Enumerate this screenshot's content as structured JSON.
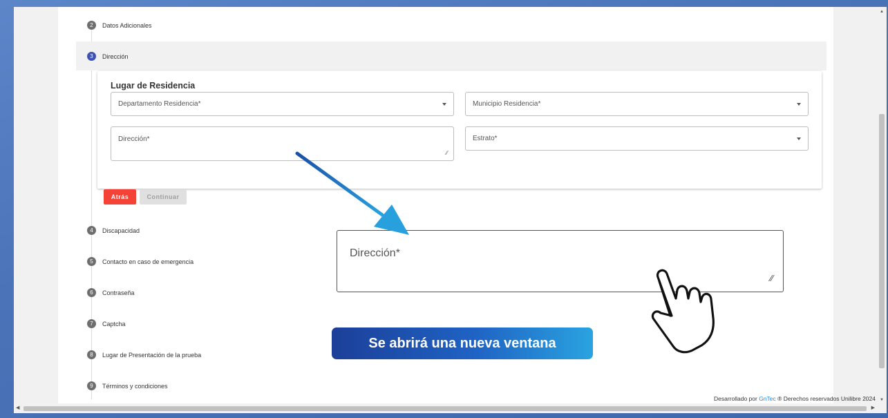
{
  "steps": [
    {
      "num": "2",
      "label": "Datos Adicionales"
    },
    {
      "num": "3",
      "label": "Dirección"
    },
    {
      "num": "4",
      "label": "Discapacidad"
    },
    {
      "num": "5",
      "label": "Contacto en caso de emergencia"
    },
    {
      "num": "6",
      "label": "Contraseña"
    },
    {
      "num": "7",
      "label": "Captcha"
    },
    {
      "num": "8",
      "label": "Lugar de Presentación de la prueba"
    },
    {
      "num": "9",
      "label": "Términos y condiciones"
    }
  ],
  "form": {
    "section_title": "Lugar de Residencia",
    "departamento_placeholder": "Departamento Residencia*",
    "municipio_placeholder": "Municipio Residencia*",
    "direccion_placeholder": "Dirección*",
    "estrato_placeholder": "Estrato*"
  },
  "buttons": {
    "back": "Atrás",
    "next": "Continuar"
  },
  "callout": {
    "zoom_label": "Dirección*",
    "banner": "Se abrirá una nueva ventana"
  },
  "footer": {
    "prefix": "Desarrollado por ",
    "link": "GnTec",
    "suffix": " ® Derechos reservados Unilibre 2024"
  },
  "colors": {
    "accent": "#3f51b5",
    "danger": "#f44336",
    "banner_start": "#1c3f99",
    "banner_end": "#2aa3e0",
    "arrow": "#1e7fd6"
  }
}
